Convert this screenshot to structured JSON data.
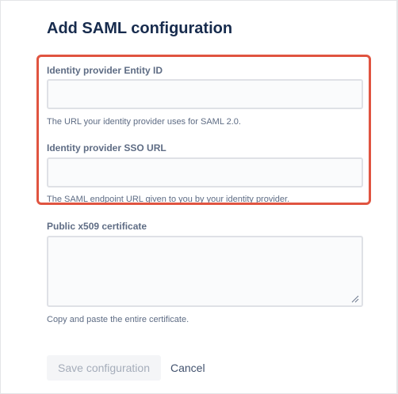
{
  "dialog": {
    "title": "Add SAML configuration"
  },
  "fields": {
    "entity_id": {
      "label": "Identity provider Entity ID",
      "value": "",
      "placeholder": "",
      "helper": "The URL your identity provider uses for SAML 2.0."
    },
    "sso_url": {
      "label": "Identity provider SSO URL",
      "value": "",
      "placeholder": "",
      "helper": "The SAML endpoint URL given to you by your identity provider."
    },
    "certificate": {
      "label": "Public x509 certificate",
      "value": "",
      "placeholder": "",
      "helper": "Copy and paste the entire certificate."
    }
  },
  "actions": {
    "save_label": "Save configuration",
    "cancel_label": "Cancel"
  },
  "colors": {
    "highlight": "#e05440",
    "title": "#172b4d",
    "label": "#5e6c84",
    "button_disabled_bg": "#f4f5f7",
    "button_disabled_text": "#a5adba"
  }
}
